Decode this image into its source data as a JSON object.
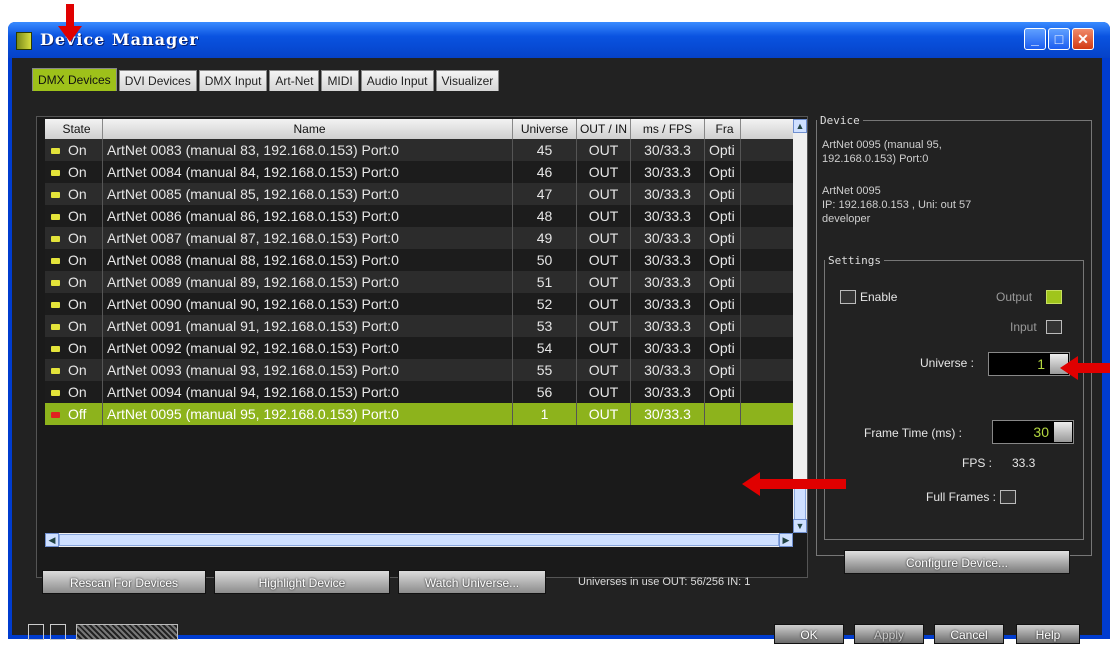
{
  "window": {
    "title": "Device Manager"
  },
  "tabs": [
    "DMX Devices",
    "DVI Devices",
    "DMX Input",
    "Art-Net",
    "MIDI",
    "Audio Input",
    "Visualizer"
  ],
  "table": {
    "columns": [
      "State",
      "Name",
      "Universe",
      "OUT / IN",
      "ms / FPS",
      "Fra"
    ],
    "rows": [
      {
        "state": "On",
        "name": "ArtNet 0083 (manual 83, 192.168.0.153) Port:0",
        "universe": "45",
        "outin": "OUT",
        "msfps": "30/33.3",
        "frame": "Opti"
      },
      {
        "state": "On",
        "name": "ArtNet 0084 (manual 84, 192.168.0.153) Port:0",
        "universe": "46",
        "outin": "OUT",
        "msfps": "30/33.3",
        "frame": "Opti"
      },
      {
        "state": "On",
        "name": "ArtNet 0085 (manual 85, 192.168.0.153) Port:0",
        "universe": "47",
        "outin": "OUT",
        "msfps": "30/33.3",
        "frame": "Opti"
      },
      {
        "state": "On",
        "name": "ArtNet 0086 (manual 86, 192.168.0.153) Port:0",
        "universe": "48",
        "outin": "OUT",
        "msfps": "30/33.3",
        "frame": "Opti"
      },
      {
        "state": "On",
        "name": "ArtNet 0087 (manual 87, 192.168.0.153) Port:0",
        "universe": "49",
        "outin": "OUT",
        "msfps": "30/33.3",
        "frame": "Opti"
      },
      {
        "state": "On",
        "name": "ArtNet 0088 (manual 88, 192.168.0.153) Port:0",
        "universe": "50",
        "outin": "OUT",
        "msfps": "30/33.3",
        "frame": "Opti"
      },
      {
        "state": "On",
        "name": "ArtNet 0089 (manual 89, 192.168.0.153) Port:0",
        "universe": "51",
        "outin": "OUT",
        "msfps": "30/33.3",
        "frame": "Opti"
      },
      {
        "state": "On",
        "name": "ArtNet 0090 (manual 90, 192.168.0.153) Port:0",
        "universe": "52",
        "outin": "OUT",
        "msfps": "30/33.3",
        "frame": "Opti"
      },
      {
        "state": "On",
        "name": "ArtNet 0091 (manual 91, 192.168.0.153) Port:0",
        "universe": "53",
        "outin": "OUT",
        "msfps": "30/33.3",
        "frame": "Opti"
      },
      {
        "state": "On",
        "name": "ArtNet 0092 (manual 92, 192.168.0.153) Port:0",
        "universe": "54",
        "outin": "OUT",
        "msfps": "30/33.3",
        "frame": "Opti"
      },
      {
        "state": "On",
        "name": "ArtNet 0093 (manual 93, 192.168.0.153) Port:0",
        "universe": "55",
        "outin": "OUT",
        "msfps": "30/33.3",
        "frame": "Opti"
      },
      {
        "state": "On",
        "name": "ArtNet 0094 (manual 94, 192.168.0.153) Port:0",
        "universe": "56",
        "outin": "OUT",
        "msfps": "30/33.3",
        "frame": "Opti"
      },
      {
        "state": "Off",
        "name": "ArtNet 0095 (manual 95, 192.168.0.153) Port:0",
        "universe": "1",
        "outin": "OUT",
        "msfps": "30/33.3",
        "frame": "",
        "selected": true
      }
    ]
  },
  "buttons": {
    "rescan": "Rescan For Devices",
    "highlight": "Highlight Device",
    "watch": "Watch Universe..."
  },
  "usage": "Universes in use OUT: 56/256  IN: 1",
  "device": {
    "legend": "Device",
    "line1": "ArtNet 0095 (manual 95,",
    "line2": "192.168.0.153) Port:0",
    "line3": "ArtNet 0095",
    "line4": "IP: 192.168.0.153 , Uni: out 57",
    "line5": "developer"
  },
  "settings": {
    "legend": "Settings",
    "enable": "Enable",
    "output": "Output",
    "input": "Input",
    "universe_label": "Universe :",
    "universe_value": "1",
    "frame_time_label": "Frame Time (ms) :",
    "frame_time_value": "30",
    "fps_label": "FPS :",
    "fps_value": "33.3",
    "full_frames": "Full Frames :",
    "configure": "Configure Device..."
  },
  "dialog": {
    "ok": "OK",
    "apply": "Apply",
    "cancel": "Cancel",
    "help": "Help"
  },
  "colors": {
    "accent": "#9ec11a",
    "selected_row": "#8db31c",
    "arrow": "#e00000"
  }
}
